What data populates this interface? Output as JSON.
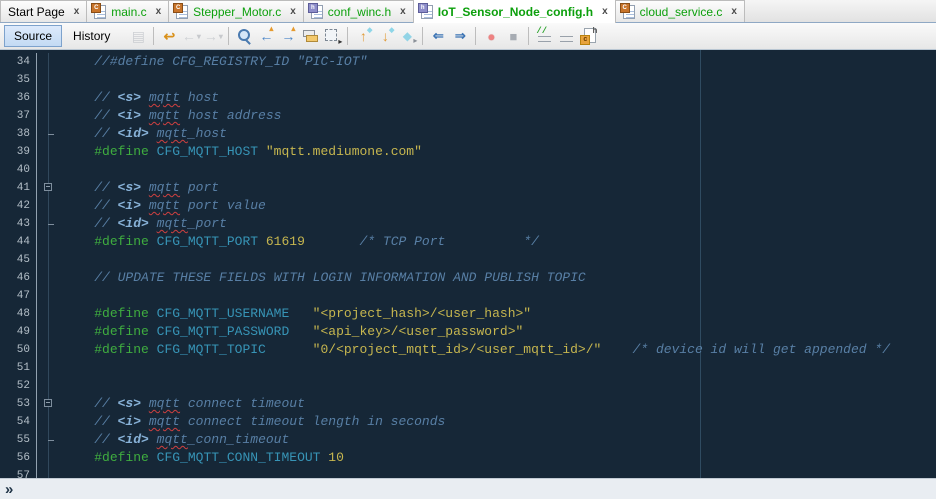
{
  "tabs": [
    {
      "label": "Start Page",
      "icon": null,
      "badge": null,
      "green": false,
      "active": false
    },
    {
      "label": "main.c",
      "icon": "c",
      "badge": "C",
      "green": true,
      "active": false
    },
    {
      "label": "Stepper_Motor.c",
      "icon": "c",
      "badge": "C",
      "green": true,
      "active": false
    },
    {
      "label": "conf_winc.h",
      "icon": "h",
      "badge": "h",
      "green": true,
      "active": false
    },
    {
      "label": "IoT_Sensor_Node_config.h",
      "icon": "h",
      "badge": "h",
      "green": true,
      "active": true
    },
    {
      "label": "cloud_service.c",
      "icon": "c",
      "badge": "C",
      "green": true,
      "active": false
    }
  ],
  "tabbar": {
    "close_glyph": "x"
  },
  "toolbar": {
    "source_label": "Source",
    "history_label": "History",
    "icons": [
      {
        "name": "last-edit-document-icon",
        "cls": "ic-doc ic-disabled",
        "glyph": "▤",
        "disabled": true
      },
      {
        "sep": true
      },
      {
        "name": "jump-last-edit-icon",
        "cls": "ic-jump",
        "glyph": "↩"
      },
      {
        "name": "back-icon",
        "cls": "ic-nav ic-disabled",
        "glyph": "←",
        "caret": "▾",
        "disabled": true
      },
      {
        "name": "forward-icon",
        "cls": "ic-nav ic-disabled",
        "glyph": "→",
        "caret": "▾",
        "disabled": true
      },
      {
        "sep": true
      },
      {
        "name": "find-selection-icon",
        "cls": "ic-magnifier"
      },
      {
        "name": "find-previous-occurrence-icon",
        "cls": "ic-find",
        "glyph": "←",
        "caret": "▴"
      },
      {
        "name": "find-next-occurrence-icon",
        "cls": "ic-find",
        "glyph": "→",
        "caret": "▴"
      },
      {
        "name": "toggle-highlight-search-icon",
        "cls": "ic-highlight"
      },
      {
        "name": "rectangular-selection-icon",
        "cls": "ic-rectsel",
        "glyph": "▸"
      },
      {
        "sep": true
      },
      {
        "name": "previous-bookmark-icon",
        "cls": "ic-bookmark",
        "glyph": "↑",
        "caret": "◆"
      },
      {
        "name": "next-bookmark-icon",
        "cls": "ic-bookmark",
        "glyph": "↓",
        "caret": "◆"
      },
      {
        "name": "toggle-bookmark-icon",
        "cls": "ic-flag",
        "glyph": "◆",
        "caret": "▸"
      },
      {
        "sep": true
      },
      {
        "name": "shift-line-left-icon",
        "cls": "ic-shift",
        "glyph": "⇐"
      },
      {
        "name": "shift-line-right-icon",
        "cls": "ic-shift",
        "glyph": "⇒"
      },
      {
        "sep": true
      },
      {
        "name": "start-macro-recording-icon",
        "cls": "ic-record",
        "glyph": "●"
      },
      {
        "name": "stop-macro-recording-icon",
        "cls": "ic-stop",
        "glyph": "■"
      },
      {
        "sep": true
      },
      {
        "name": "comment-icon",
        "cls": "ic-lines ic-comment",
        "glyph": "//"
      },
      {
        "name": "uncomment-icon",
        "cls": "ic-lines ic-uncomment"
      },
      {
        "name": "toggle-header-source-icon",
        "cls": "ic-pagech",
        "glyph": "c",
        "caret": "h"
      }
    ]
  },
  "editor": {
    "right_margin_column": 80,
    "lines": [
      {
        "n": 34,
        "fold": "",
        "s": [
          [
            "cmt",
            "    //#define CFG_REGISTRY_ID \"PIC-IOT\""
          ]
        ]
      },
      {
        "n": 35,
        "fold": "",
        "s": []
      },
      {
        "n": 36,
        "fold": "",
        "s": [
          [
            "cmt",
            "    // "
          ],
          [
            "tag",
            "<s>"
          ],
          [
            "cmt",
            " "
          ],
          [
            "sq",
            "mqtt"
          ],
          [
            "cmt",
            " host"
          ]
        ]
      },
      {
        "n": 37,
        "fold": "",
        "s": [
          [
            "cmt",
            "    // "
          ],
          [
            "tag",
            "<i>"
          ],
          [
            "cmt",
            " "
          ],
          [
            "sq",
            "mqtt"
          ],
          [
            "cmt",
            " host address"
          ]
        ]
      },
      {
        "n": 38,
        "fold": "end",
        "s": [
          [
            "cmt",
            "    // "
          ],
          [
            "tag",
            "<id>"
          ],
          [
            "cmt",
            " "
          ],
          [
            "sq",
            "mqtt"
          ],
          [
            "cmt",
            "_host"
          ]
        ]
      },
      {
        "n": 39,
        "fold": "",
        "s": [
          [
            "ws",
            "    "
          ],
          [
            "pre",
            "#define"
          ],
          [
            "ws",
            " "
          ],
          [
            "id",
            "CFG_MQTT_HOST"
          ],
          [
            "ws",
            " "
          ],
          [
            "str",
            "\"mqtt.mediumone.com\""
          ]
        ]
      },
      {
        "n": 40,
        "fold": "",
        "s": []
      },
      {
        "n": 41,
        "fold": "start",
        "s": [
          [
            "cmt",
            "    // "
          ],
          [
            "tag",
            "<s>"
          ],
          [
            "cmt",
            " "
          ],
          [
            "sq",
            "mqtt"
          ],
          [
            "cmt",
            " port"
          ]
        ]
      },
      {
        "n": 42,
        "fold": "",
        "s": [
          [
            "cmt",
            "    // "
          ],
          [
            "tag",
            "<i>"
          ],
          [
            "cmt",
            " "
          ],
          [
            "sq",
            "mqtt"
          ],
          [
            "cmt",
            " port value"
          ]
        ]
      },
      {
        "n": 43,
        "fold": "end",
        "s": [
          [
            "cmt",
            "    // "
          ],
          [
            "tag",
            "<id>"
          ],
          [
            "cmt",
            " "
          ],
          [
            "sq",
            "mqtt"
          ],
          [
            "cmt",
            "_port"
          ]
        ]
      },
      {
        "n": 44,
        "fold": "",
        "s": [
          [
            "ws",
            "    "
          ],
          [
            "pre",
            "#define"
          ],
          [
            "ws",
            " "
          ],
          [
            "id",
            "CFG_MQTT_PORT"
          ],
          [
            "ws",
            " "
          ],
          [
            "str",
            "61619"
          ],
          [
            "ws",
            "       "
          ],
          [
            "cmt",
            "/* TCP Port          */"
          ]
        ]
      },
      {
        "n": 45,
        "fold": "",
        "s": []
      },
      {
        "n": 46,
        "fold": "",
        "s": [
          [
            "cmt",
            "    // UPDATE THESE FIELDS WITH LOGIN INFORMATION AND PUBLISH TOPIC"
          ]
        ]
      },
      {
        "n": 47,
        "fold": "",
        "s": []
      },
      {
        "n": 48,
        "fold": "",
        "s": [
          [
            "ws",
            "    "
          ],
          [
            "pre",
            "#define"
          ],
          [
            "ws",
            " "
          ],
          [
            "id",
            "CFG_MQTT_USERNAME"
          ],
          [
            "ws",
            "   "
          ],
          [
            "str",
            "\"<project_hash>/<user_hash>\""
          ]
        ]
      },
      {
        "n": 49,
        "fold": "",
        "s": [
          [
            "ws",
            "    "
          ],
          [
            "pre",
            "#define"
          ],
          [
            "ws",
            " "
          ],
          [
            "id",
            "CFG_MQTT_PASSWORD"
          ],
          [
            "ws",
            "   "
          ],
          [
            "str",
            "\"<api_key>/<user_password>\""
          ]
        ]
      },
      {
        "n": 50,
        "fold": "",
        "s": [
          [
            "ws",
            "    "
          ],
          [
            "pre",
            "#define"
          ],
          [
            "ws",
            " "
          ],
          [
            "id",
            "CFG_MQTT_TOPIC"
          ],
          [
            "ws",
            "      "
          ],
          [
            "str",
            "\"0/<project_mqtt_id>/<user_mqtt_id>/\""
          ],
          [
            "ws",
            "    "
          ],
          [
            "cmt",
            "/* device id will get appended */"
          ]
        ]
      },
      {
        "n": 51,
        "fold": "",
        "s": []
      },
      {
        "n": 52,
        "fold": "",
        "s": []
      },
      {
        "n": 53,
        "fold": "start",
        "s": [
          [
            "cmt",
            "    // "
          ],
          [
            "tag",
            "<s>"
          ],
          [
            "cmt",
            " "
          ],
          [
            "sq",
            "mqtt"
          ],
          [
            "cmt",
            " connect timeout"
          ]
        ]
      },
      {
        "n": 54,
        "fold": "",
        "s": [
          [
            "cmt",
            "    // "
          ],
          [
            "tag",
            "<i>"
          ],
          [
            "cmt",
            " "
          ],
          [
            "sq",
            "mqtt"
          ],
          [
            "cmt",
            " connect timeout length in seconds"
          ]
        ]
      },
      {
        "n": 55,
        "fold": "end",
        "s": [
          [
            "cmt",
            "    // "
          ],
          [
            "tag",
            "<id>"
          ],
          [
            "cmt",
            " "
          ],
          [
            "sq",
            "mqtt"
          ],
          [
            "cmt",
            "_conn_timeout"
          ]
        ]
      },
      {
        "n": 56,
        "fold": "",
        "s": [
          [
            "ws",
            "    "
          ],
          [
            "pre",
            "#define"
          ],
          [
            "ws",
            " "
          ],
          [
            "id",
            "CFG_MQTT_CONN_TIMEOUT"
          ],
          [
            "ws",
            " "
          ],
          [
            "str",
            "10"
          ]
        ]
      },
      {
        "n": 57,
        "fold": "",
        "s": []
      }
    ]
  },
  "statusbar": {
    "chevron": "»"
  },
  "colors": {
    "editor_bg": "#162737",
    "comment": "#587fa5",
    "doc_tag": "#87b1d7",
    "preprocessor": "#3fad3f",
    "identifier": "#3794b6",
    "string": "#c6b64f",
    "squiggle": "#cf4040",
    "line_number": "#b4bfc8",
    "tab_file_green": "#0da00d",
    "guide_line": "#2f4b61",
    "source_selected_bg": "#c3daf3"
  }
}
